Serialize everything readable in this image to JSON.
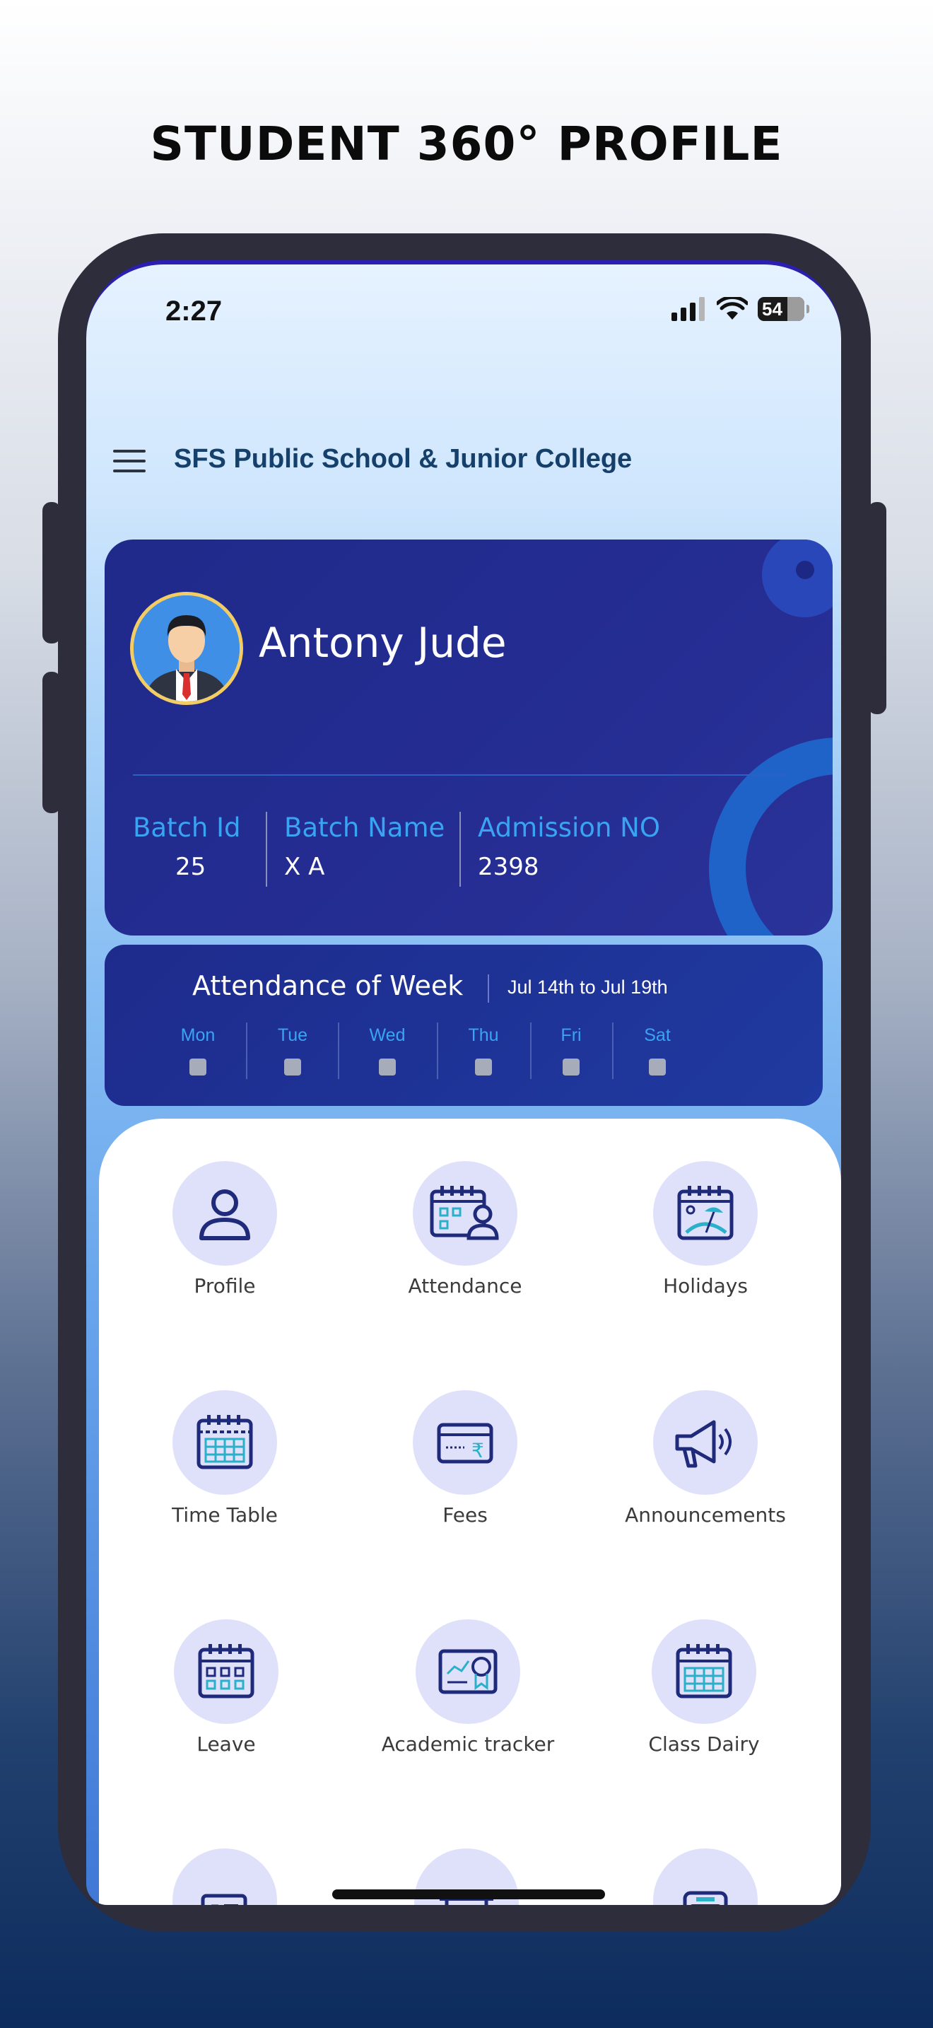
{
  "headline": "STUDENT 360° PROFILE",
  "status_bar": {
    "time": "2:27",
    "battery": "54"
  },
  "app": {
    "school_name": "SFS Public School & Junior College"
  },
  "student": {
    "name": "Antony Jude",
    "batch_id_label": "Batch Id",
    "batch_id": "25",
    "batch_name_label": "Batch Name",
    "batch_name": "X A",
    "admission_label": "Admission NO",
    "admission_no": "2398"
  },
  "attendance": {
    "title": "Attendance of Week",
    "range": "Jul 14th to Jul 19th",
    "days": [
      "Mon",
      "Tue",
      "Wed",
      "Thu",
      "Fri",
      "Sat"
    ]
  },
  "menu": [
    {
      "label": "Profile",
      "icon": "person-icon"
    },
    {
      "label": "Attendance",
      "icon": "attendance-calendar-icon"
    },
    {
      "label": "Holidays",
      "icon": "holiday-calendar-icon"
    },
    {
      "label": "Time Table",
      "icon": "timetable-calendar-icon"
    },
    {
      "label": "Fees",
      "icon": "rupee-card-icon"
    },
    {
      "label": "Announcements",
      "icon": "megaphone-icon"
    },
    {
      "label": "Leave",
      "icon": "leave-calendar-icon"
    },
    {
      "label": "Academic tracker",
      "icon": "certificate-chart-icon"
    },
    {
      "label": "Class Dairy",
      "icon": "diary-calendar-icon"
    }
  ],
  "colors": {
    "accent": "#3aa4f3",
    "card": "#232d90",
    "icon_stroke": "#1f2a7a",
    "icon_accent": "#2bb0c9"
  }
}
